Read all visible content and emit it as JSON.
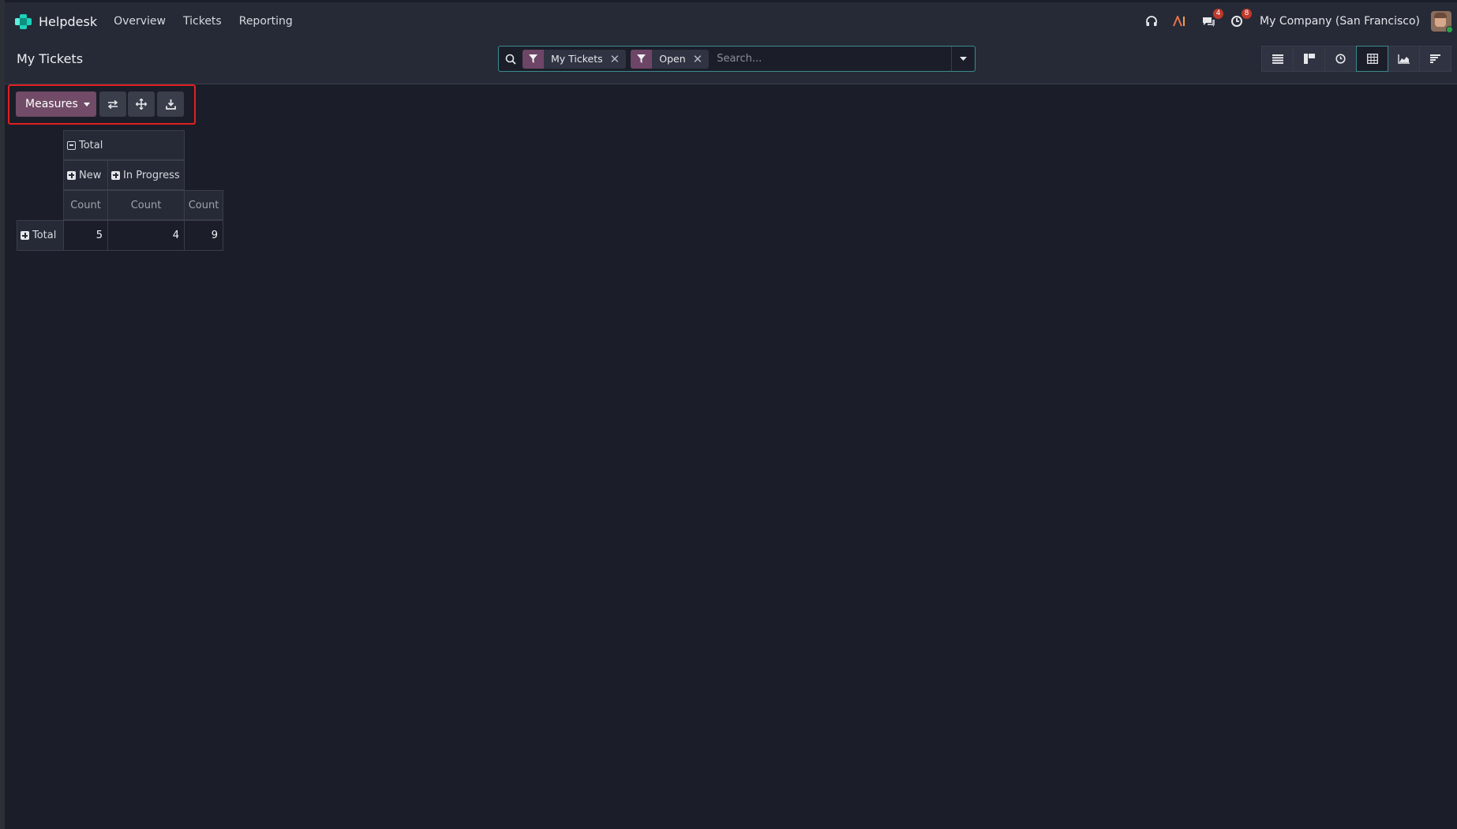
{
  "app": {
    "name": "Helpdesk",
    "menu": [
      "Overview",
      "Tickets",
      "Reporting"
    ]
  },
  "systray": {
    "messages_count": "4",
    "activities_count": "8",
    "company": "My Company (San Francisco)"
  },
  "control_panel": {
    "title": "My Tickets",
    "facets": [
      {
        "label": "My Tickets",
        "icon": "filter-icon"
      },
      {
        "label": "Open",
        "icon": "filter-icon"
      }
    ],
    "search_placeholder": "Search...",
    "views": [
      "list-view",
      "kanban-view",
      "activity-view",
      "pivot-view",
      "graph-view",
      "cohort-view"
    ],
    "active_view": "pivot-view"
  },
  "pivot_toolbar": {
    "measures_label": "Measures",
    "buttons": [
      "flip-axis-icon",
      "expand-all-icon",
      "download-icon"
    ]
  },
  "pivot": {
    "col_root": "Total",
    "col_groups": [
      "New",
      "In Progress"
    ],
    "measure": "Count",
    "row_header": "Total",
    "values": [
      "5",
      "4",
      "9"
    ]
  },
  "colors": {
    "primary": "#714b67",
    "accent": "#3b8b8e",
    "background": "#1b1e29",
    "highlight_box": "#e02020"
  }
}
